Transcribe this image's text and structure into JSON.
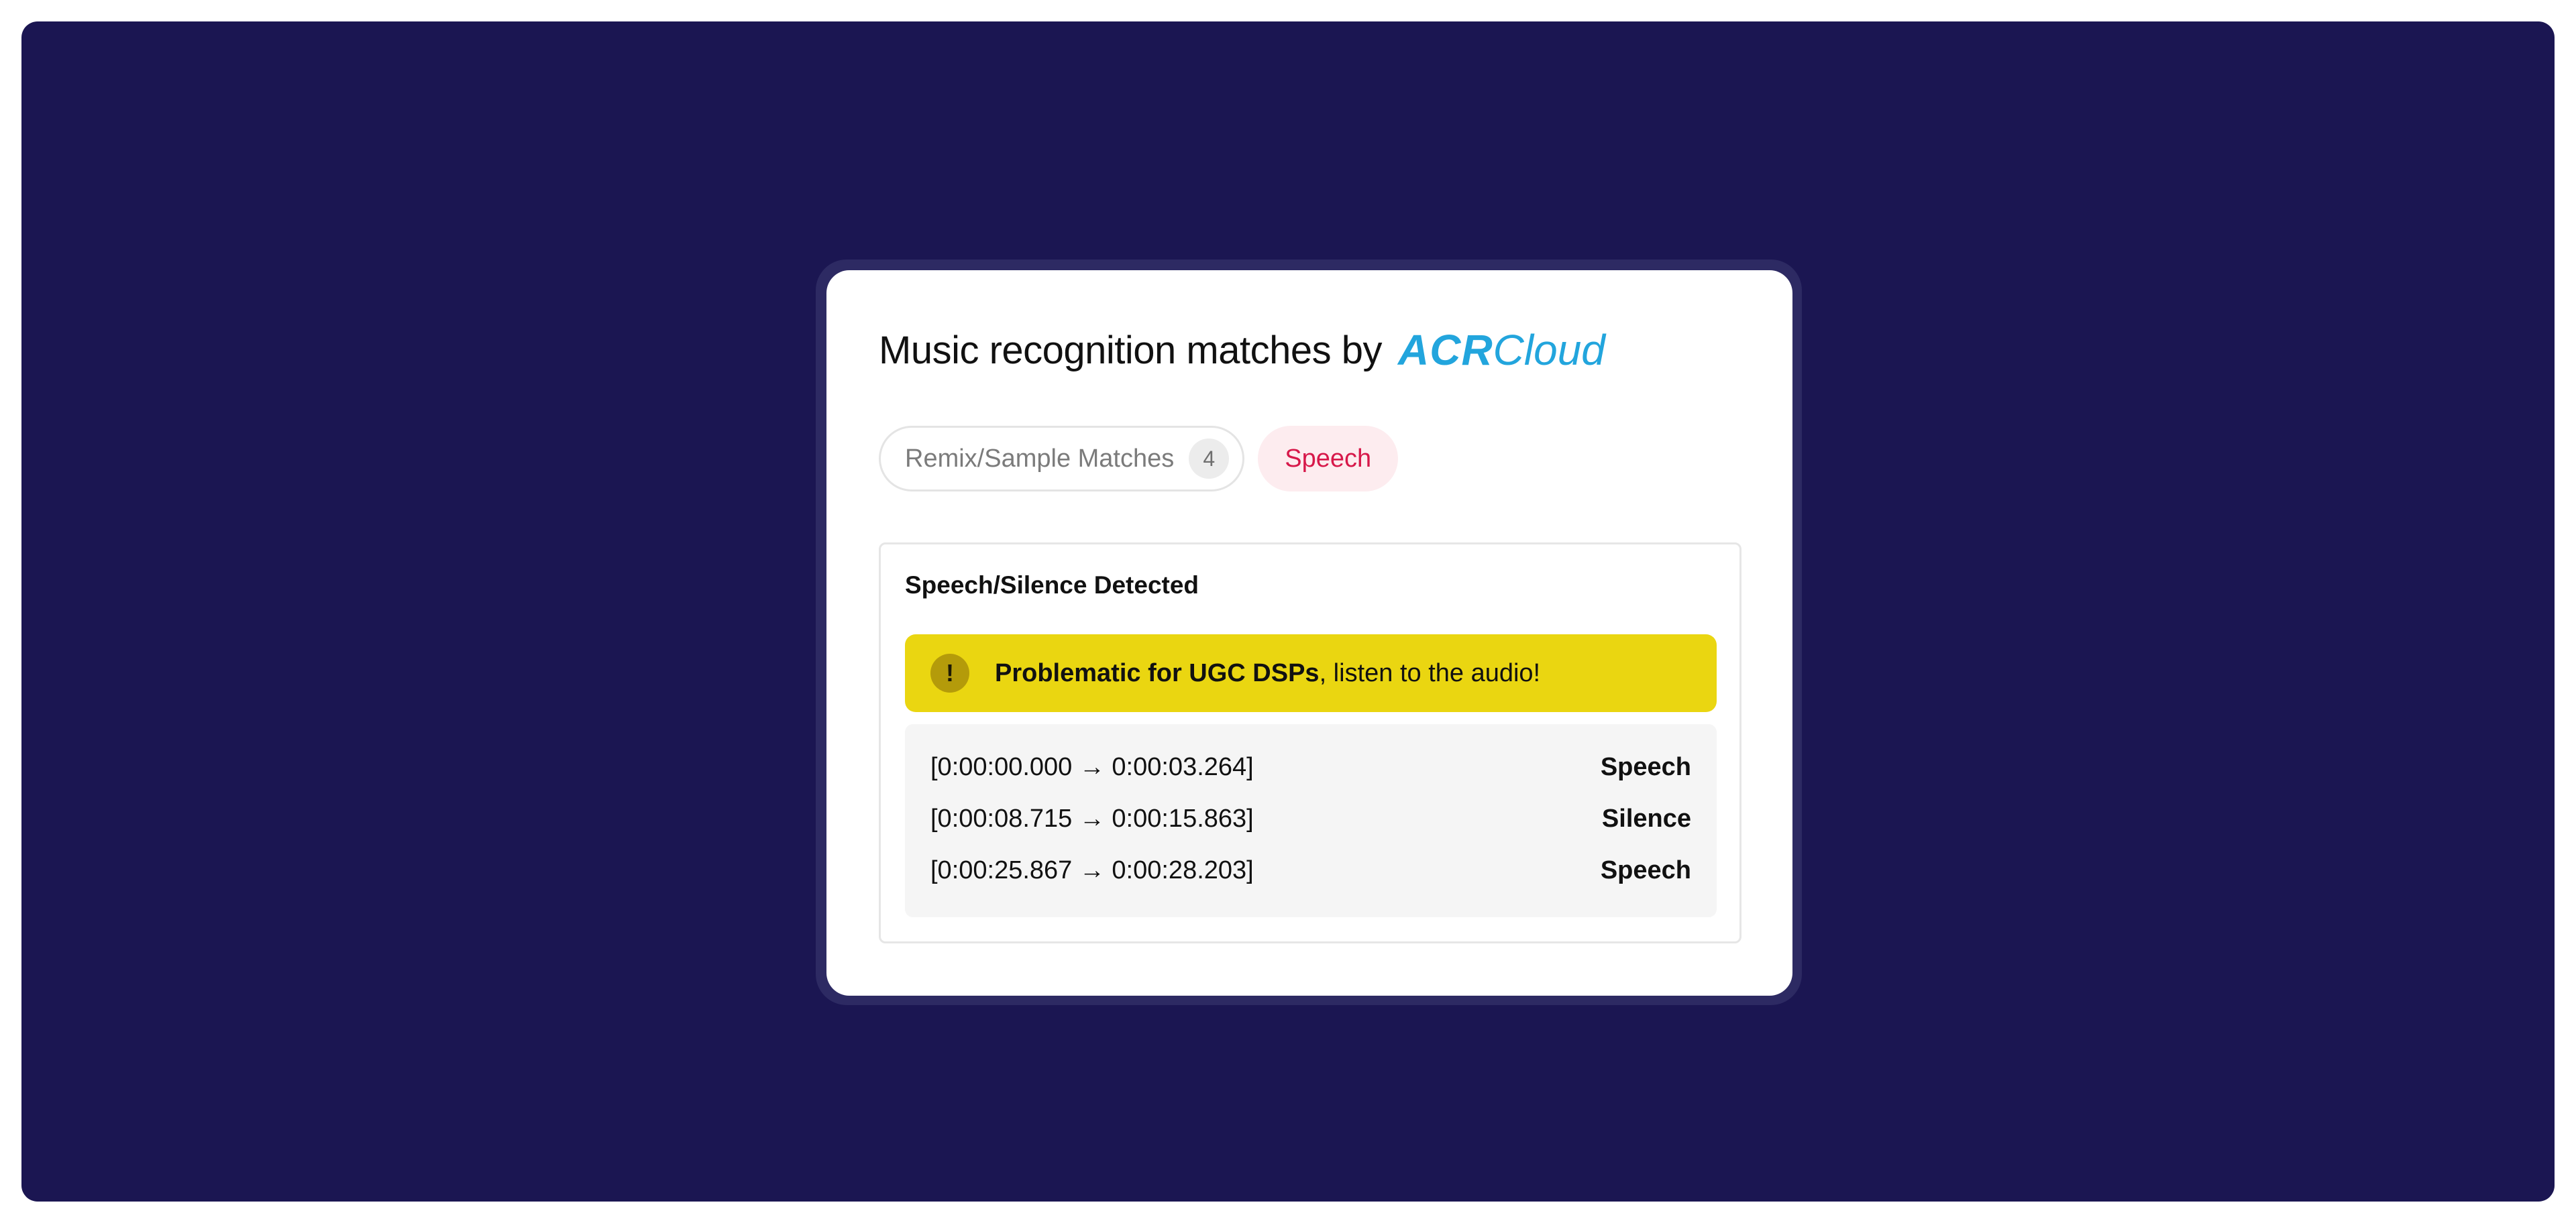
{
  "header": {
    "title": "Music recognition matches by",
    "brand_strong": "ACR",
    "brand_light": "Cloud"
  },
  "tabs": [
    {
      "label": "Remix/Sample Matches",
      "count": "4",
      "active": false
    },
    {
      "label": "Speech",
      "active": true
    }
  ],
  "panel": {
    "title": "Speech/Silence Detected",
    "warning": {
      "icon": "exclamation-icon",
      "bold_text": "Problematic for UGC DSPs",
      "rest_text": ", listen to the audio!"
    },
    "segments": [
      {
        "range": "[0:00:00.000 → 0:00:03.264]",
        "label": "Speech"
      },
      {
        "range": "[0:00:08.715 → 0:00:15.863]",
        "label": "Silence"
      },
      {
        "range": "[0:00:25.867 → 0:00:28.203]",
        "label": "Speech"
      }
    ]
  },
  "colors": {
    "background": "#1b1652",
    "brand": "#22a5dd",
    "active_tab_text": "#d7184a",
    "active_tab_bg": "#fdecef",
    "warning_bg": "#ead611"
  }
}
